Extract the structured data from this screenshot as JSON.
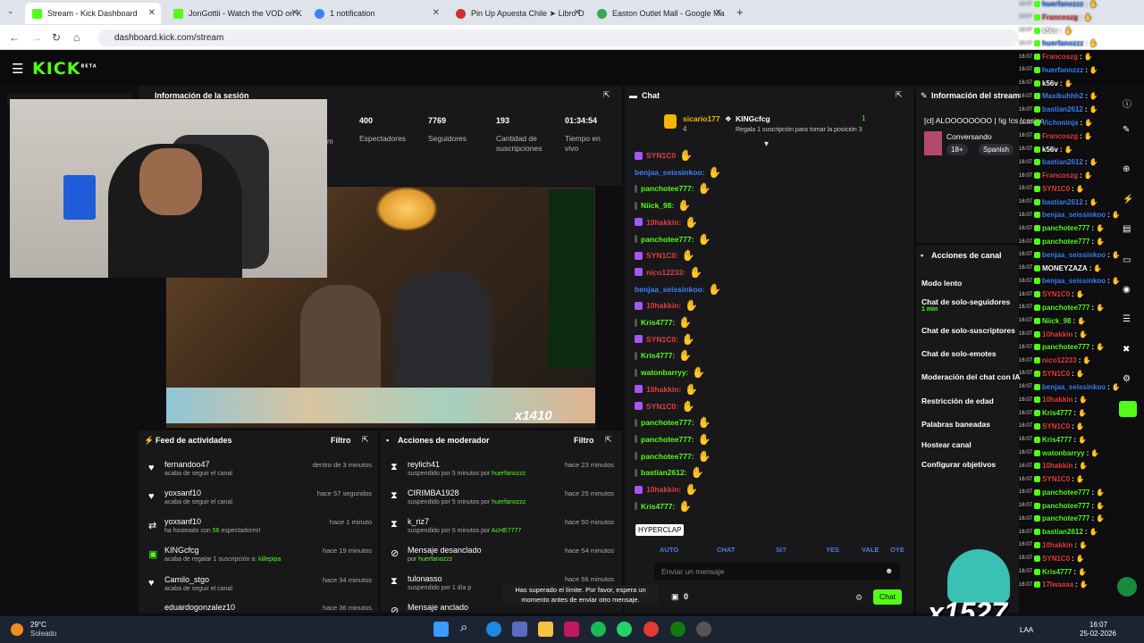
{
  "browser": {
    "tabs": [
      {
        "label": "Stream - Kick Dashboard",
        "color": "#53fc18"
      },
      {
        "label": "JonGottii - Watch the VOD on K",
        "color": "#53fc18"
      },
      {
        "label": "1 notification",
        "color": "#3b82f6"
      },
      {
        "label": "Pin Up Apuesta Chile ➤ Libro D",
        "color": "#d12f2f"
      },
      {
        "label": "Easton Outlet Mall - Google Ma",
        "color": "#34a853"
      }
    ],
    "new_tab": "+",
    "url": "dashboard.kick.com/stream"
  },
  "kick": {
    "logo": "KICK",
    "beta": "BETA"
  },
  "session": {
    "title": "Información de la sesión",
    "stats": [
      {
        "value": "400",
        "label": "Espectadores"
      },
      {
        "value": "7769",
        "label": "Seguidores"
      },
      {
        "value": "193",
        "label": "Cantidad de suscripciones"
      },
      {
        "value": "01:34:54",
        "label": "Tiempo en vivo"
      }
    ],
    "partial": "m"
  },
  "video": {
    "multiplier": "x1410"
  },
  "activity": {
    "title": "Feed de actividades",
    "filter": "Filtro",
    "items": [
      {
        "name": "fernandoo47",
        "desc": "acaba de seguir el canal",
        "time": "dentro de 3 minutos",
        "icon": "heart-icon"
      },
      {
        "name": "yoxsanf10",
        "desc": "acaba de seguir el canal",
        "time": "hace 57 segundos",
        "icon": "heart-icon"
      },
      {
        "name": "yoxsanf10",
        "desc_pre": "ha hosteado con ",
        "desc_num": "56",
        "desc_post": " espectadores!",
        "time": "hace 1 minuto",
        "icon": "host-icon"
      },
      {
        "name": "KINGcfcg",
        "desc_pre": "acaba de regalar ",
        "desc_num": "1",
        "desc_post": " suscripción a: ",
        "desc_user": "killepipa",
        "time": "hace 19 minutos",
        "icon": "gift-icon"
      },
      {
        "name": "Camilo_stgo",
        "desc": "acaba de seguir el canal",
        "time": "hace 34 minutos",
        "icon": "heart-icon"
      },
      {
        "name": "eduardogonzalez10",
        "desc": "",
        "time": "hace 36 minutos",
        "icon": "heart-icon"
      }
    ]
  },
  "moderator": {
    "title": "Acciones de moderador",
    "filter": "Filtro",
    "items": [
      {
        "name": "reylich41",
        "desc": "suspendido por 5 minutos por ",
        "by": "huerfanozzz",
        "time": "hace 23 minutos"
      },
      {
        "name": "CIRIMBA1928",
        "desc": "suspendido por 5 minutos por ",
        "by": "huerfanozzz",
        "time": "hace 25 minutos"
      },
      {
        "name": "k_riz7",
        "desc": "suspendido por 5 minutos por ",
        "by": "AcHE7777",
        "time": "hace 50 minutos"
      },
      {
        "name": "Mensaje desanclado",
        "desc": "por ",
        "by": "huerfanozzz",
        "time": "hace 54 minutos"
      },
      {
        "name": "tulonasso",
        "desc": "suspendido por 1 día p",
        "by": "",
        "time": "hace 56 minutos"
      },
      {
        "name": "Mensaje anclado",
        "desc": "",
        "by": "",
        "time": ""
      }
    ]
  },
  "chat": {
    "title": "Chat",
    "leader": {
      "name": "sicario177",
      "count": "4",
      "gifter": "KINGcfcg",
      "gifter_count": "1",
      "promo": "Regala 1 suscripción para tomar la posición 3"
    },
    "messages": [
      {
        "user": "SYN1C0",
        "color": "#e53e3e"
      },
      {
        "user": "benjaa_seissinkoo:",
        "color": "#3b82f6"
      },
      {
        "user": "panchotee777:",
        "color": "#53fc18"
      },
      {
        "user": "Niick_98:",
        "color": "#53fc18"
      },
      {
        "user": "10hakkin:",
        "color": "#e53e3e"
      },
      {
        "user": "panchotee777:",
        "color": "#53fc18"
      },
      {
        "user": "SYN1C0:",
        "color": "#e53e3e"
      },
      {
        "user": "nico12233:",
        "color": "#e53e3e"
      },
      {
        "user": "benjaa_seissinkoo:",
        "color": "#3b82f6"
      },
      {
        "user": "10hakkin:",
        "color": "#e53e3e"
      },
      {
        "user": "Kris4777:",
        "color": "#53fc18"
      },
      {
        "user": "SYN1C0:",
        "color": "#e53e3e"
      },
      {
        "user": "Kris4777:",
        "color": "#53fc18"
      },
      {
        "user": "watonbarryy:",
        "color": "#53fc18"
      },
      {
        "user": "10hakkin:",
        "color": "#e53e3e"
      },
      {
        "user": "SYN1C0:",
        "color": "#e53e3e"
      },
      {
        "user": "panchotee777:",
        "color": "#53fc18"
      },
      {
        "user": "panchotee777:",
        "color": "#53fc18"
      },
      {
        "user": "panchotee777:",
        "color": "#53fc18"
      },
      {
        "user": "bastian2612:",
        "color": "#53fc18"
      },
      {
        "user": "10hakkin:",
        "color": "#e53e3e"
      },
      {
        "user": "Kris4777:",
        "color": "#53fc18"
      }
    ],
    "tooltip": "HYPERCLAP",
    "emote_labels": [
      "AUTO",
      "CHAT",
      "SI?",
      "YES",
      "VALE",
      "OYE"
    ],
    "input_placeholder": "Enviar un mensaje",
    "points": "0",
    "send": "Chat",
    "toast": "Has superado el límite. Por favor, espera un momento antes de enviar otro mensaje."
  },
  "stream_info": {
    "title": "Información del stream",
    "stream_title": "[cl] ALOOOOOOOO | !ig !cs !casino",
    "category": "Conversando",
    "tags": [
      "18+",
      "Spanish"
    ]
  },
  "channel_actions": {
    "title": "Acciones de canal",
    "items": [
      {
        "label": "Modo lento",
        "sub": ""
      },
      {
        "label": "Chat de solo-seguidores",
        "sub": "1 min"
      },
      {
        "label": "Chat de solo-suscriptores",
        "sub": ""
      },
      {
        "label": "Chat de solo-emotes",
        "sub": ""
      },
      {
        "label": "Moderación del chat con IA",
        "sub": ""
      },
      {
        "label": "Restricción de edad",
        "sub": ""
      },
      {
        "label": "Palabras baneadas",
        "sub": ""
      },
      {
        "label": "Hostear canal",
        "sub": ""
      },
      {
        "label": "Configurar objetivos",
        "sub": ""
      }
    ]
  },
  "overlay_chat": [
    {
      "user": "huerfanozzz",
      "color": "#3b82f6"
    },
    {
      "user": "Francoszg",
      "color": "#e53e3e"
    },
    {
      "user": "k56v",
      "color": "#fff"
    },
    {
      "user": "huerfanozzz",
      "color": "#3b82f6"
    },
    {
      "user": "Francoszg",
      "color": "#e53e3e"
    },
    {
      "user": "huerfanozzz",
      "color": "#3b82f6"
    },
    {
      "user": "k56v",
      "color": "#fff"
    },
    {
      "user": "Maxikuhhh2",
      "color": "#3b82f6"
    },
    {
      "user": "bastian2612",
      "color": "#3b82f6"
    },
    {
      "user": "Vichoninja",
      "color": "#3b82f6"
    },
    {
      "user": "Francoszg",
      "color": "#e53e3e"
    },
    {
      "user": "k56v",
      "color": "#fff"
    },
    {
      "user": "bastian2612",
      "color": "#3b82f6"
    },
    {
      "user": "Francoszg",
      "color": "#e53e3e"
    },
    {
      "user": "SYN1C0",
      "color": "#e53e3e"
    },
    {
      "user": "bastian2612",
      "color": "#3b82f6"
    },
    {
      "user": "benjaa_seissinkoo",
      "color": "#3b82f6"
    },
    {
      "user": "panchotee777",
      "color": "#53fc18"
    },
    {
      "user": "panchotee777",
      "color": "#53fc18"
    },
    {
      "user": "benjaa_seissinkoo",
      "color": "#3b82f6"
    },
    {
      "user": "MONEYZAZA",
      "color": "#fff"
    },
    {
      "user": "benjaa_seissinkoo",
      "color": "#3b82f6"
    },
    {
      "user": "SYN1C0",
      "color": "#e53e3e"
    },
    {
      "user": "panchotee777",
      "color": "#53fc18"
    },
    {
      "user": "Niick_98",
      "color": "#53fc18"
    },
    {
      "user": "10hakkin",
      "color": "#e53e3e"
    },
    {
      "user": "panchotee777",
      "color": "#53fc18"
    },
    {
      "user": "nico12233",
      "color": "#e53e3e"
    },
    {
      "user": "SYN1C0",
      "color": "#e53e3e"
    },
    {
      "user": "benjaa_seissinkoo",
      "color": "#3b82f6"
    },
    {
      "user": "10hakkin",
      "color": "#e53e3e"
    },
    {
      "user": "Kris4777",
      "color": "#53fc18"
    },
    {
      "user": "SYN1C0",
      "color": "#e53e3e"
    },
    {
      "user": "Kris4777",
      "color": "#53fc18"
    },
    {
      "user": "watonbarryy",
      "color": "#53fc18"
    },
    {
      "user": "10hakkin",
      "color": "#e53e3e"
    },
    {
      "user": "SYN1C0",
      "color": "#e53e3e"
    },
    {
      "user": "panchotee777",
      "color": "#53fc18"
    },
    {
      "user": "panchotee777",
      "color": "#53fc18"
    },
    {
      "user": "panchotee777",
      "color": "#53fc18"
    },
    {
      "user": "bastian2612",
      "color": "#53fc18"
    },
    {
      "user": "10hakkin",
      "color": "#e53e3e"
    },
    {
      "user": "SYN1C0",
      "color": "#e53e3e"
    },
    {
      "user": "Kris4777",
      "color": "#53fc18"
    },
    {
      "user": "17lwaaaa",
      "color": "#e53e3e"
    }
  ],
  "overlay_multiplier": "x1527",
  "overlay_time": "16:07",
  "taskbar": {
    "weather_temp": "29°C",
    "weather_desc": "Soleado",
    "lang": "LAA",
    "time": "16:07",
    "date": "25-02-2026"
  }
}
